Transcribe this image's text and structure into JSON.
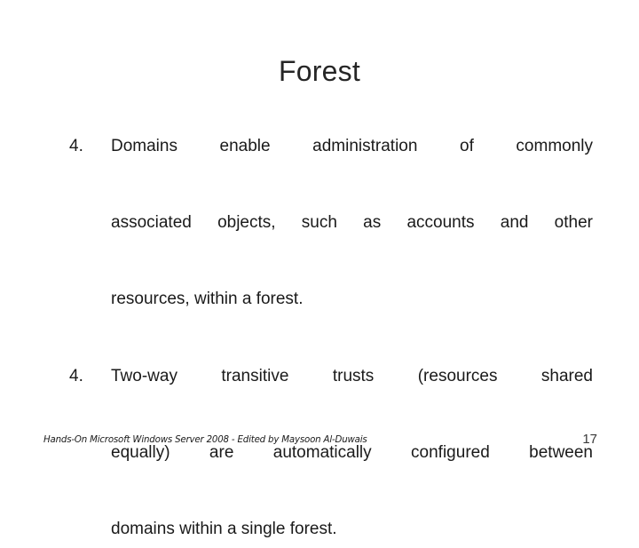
{
  "slide": {
    "title": "Forest",
    "background_color": "#ffffff",
    "text_color": "#1a1a1a"
  },
  "body": {
    "items": [
      {
        "marker": "4.",
        "lines": [
          "Domains enable administration of commonly",
          "associated objects, such as accounts and other",
          "resources, within a forest."
        ],
        "text": "Domains enable administration of commonly associated objects, such as accounts and other resources, within a forest."
      },
      {
        "marker": "4.",
        "lines": [
          "Two-way transitive trusts (resources shared",
          "equally) are automatically configured between",
          "domains within a single forest."
        ],
        "text": "Two-way transitive trusts (resources shared equally) are automatically configured between domains within a single forest."
      }
    ]
  },
  "footer": {
    "credit": "Hands-On Microsoft Windows Server 2008 - Edited by Maysoon Al-Duwais",
    "page_number": "17"
  }
}
